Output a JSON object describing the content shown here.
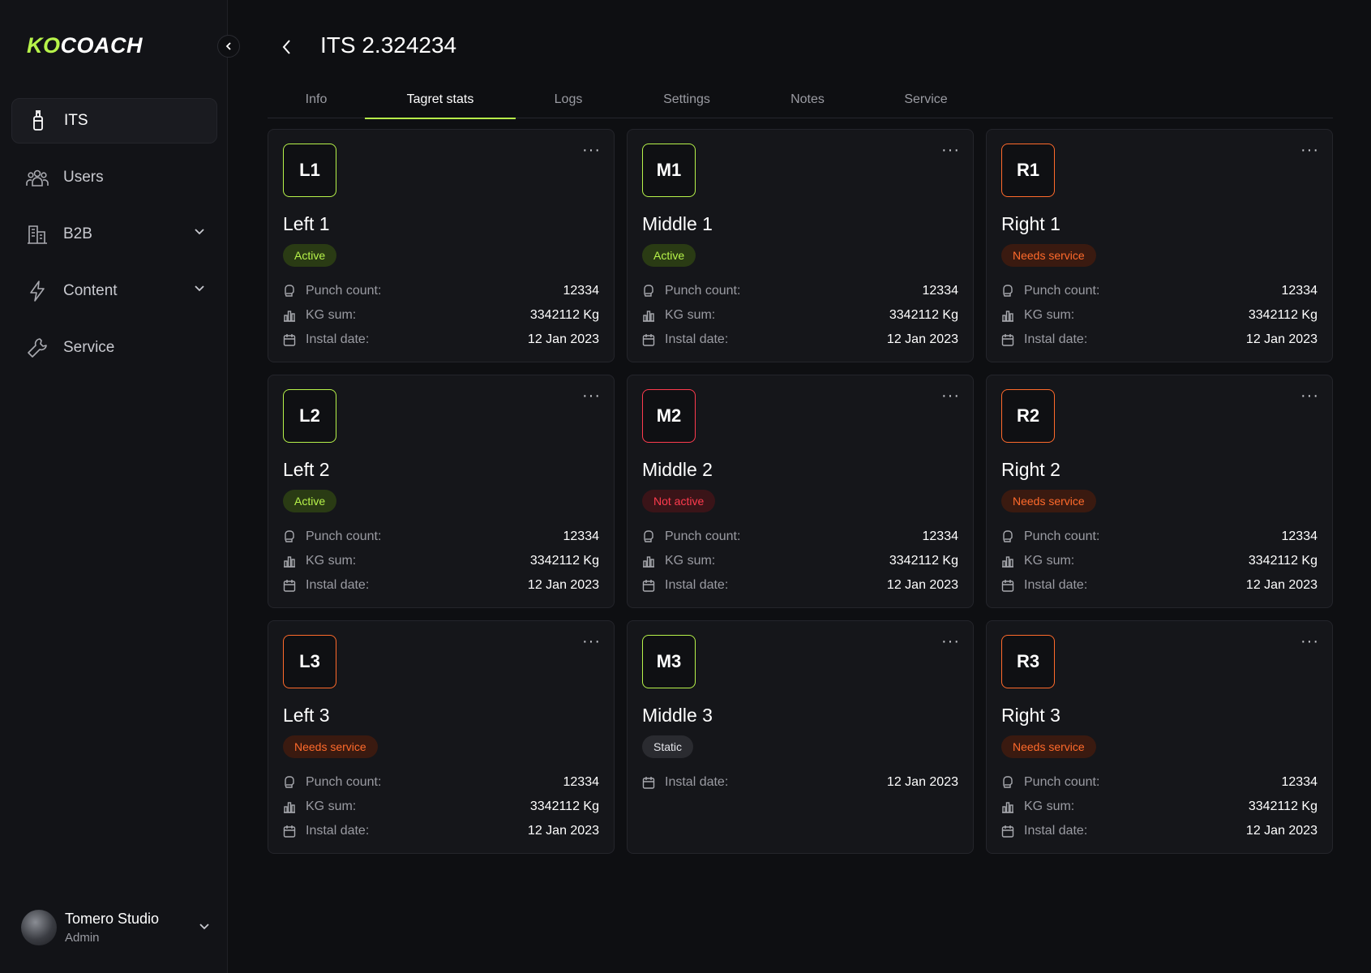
{
  "brand": {
    "part1": "KO",
    "part2": "COACH",
    "accent": "#b7f34a"
  },
  "sidebar": {
    "items": [
      {
        "label": "ITS",
        "icon": "bottle-icon",
        "active": true
      },
      {
        "label": "Users",
        "icon": "users-icon"
      },
      {
        "label": "B2B",
        "icon": "building-icon",
        "expandable": true
      },
      {
        "label": "Content",
        "icon": "bolt-icon",
        "expandable": true
      },
      {
        "label": "Service",
        "icon": "wrench-icon"
      }
    ],
    "user": {
      "name": "Tomero Studio",
      "role": "Admin"
    }
  },
  "header": {
    "title": "ITS 2.324234"
  },
  "tabs": [
    "Info",
    "Tagret stats",
    "Logs",
    "Settings",
    "Notes",
    "Service"
  ],
  "active_tab": 1,
  "labels": {
    "punch": "Punch count:",
    "kg": "KG sum:",
    "install": "Instal date:"
  },
  "cards": [
    {
      "code": "L1",
      "title": "Left 1",
      "status": "Active",
      "status_type": "active",
      "border": "#b7f34a",
      "punch": "12334",
      "kg": "3342112 Kg",
      "date": "12 Jan 2023"
    },
    {
      "code": "M1",
      "title": "Middle 1",
      "status": "Active",
      "status_type": "active",
      "border": "#b7f34a",
      "punch": "12334",
      "kg": "3342112 Kg",
      "date": "12 Jan 2023"
    },
    {
      "code": "R1",
      "title": "Right 1",
      "status": "Needs service",
      "status_type": "needs",
      "border": "#ff6a2b",
      "punch": "12334",
      "kg": "3342112 Kg",
      "date": "12 Jan 2023"
    },
    {
      "code": "L2",
      "title": "Left 2",
      "status": "Active",
      "status_type": "active",
      "border": "#b7f34a",
      "punch": "12334",
      "kg": "3342112 Kg",
      "date": "12 Jan 2023"
    },
    {
      "code": "M2",
      "title": "Middle 2",
      "status": "Not active",
      "status_type": "not",
      "border": "#ff3b4e",
      "punch": "12334",
      "kg": "3342112 Kg",
      "date": "12 Jan 2023"
    },
    {
      "code": "R2",
      "title": "Right 2",
      "status": "Needs service",
      "status_type": "needs",
      "border": "#ff6a2b",
      "punch": "12334",
      "kg": "3342112 Kg",
      "date": "12 Jan 2023"
    },
    {
      "code": "L3",
      "title": "Left 3",
      "status": "Needs service",
      "status_type": "needs",
      "border": "#ff6a2b",
      "punch": "12334",
      "kg": "3342112 Kg",
      "date": "12 Jan 2023"
    },
    {
      "code": "M3",
      "title": "Middle 3",
      "status": "Static",
      "status_type": "static",
      "border": "#b7f34a",
      "date": "12 Jan 2023"
    },
    {
      "code": "R3",
      "title": "Right 3",
      "status": "Needs service",
      "status_type": "needs",
      "border": "#ff6a2b",
      "punch": "12334",
      "kg": "3342112 Kg",
      "date": "12 Jan 2023"
    }
  ]
}
